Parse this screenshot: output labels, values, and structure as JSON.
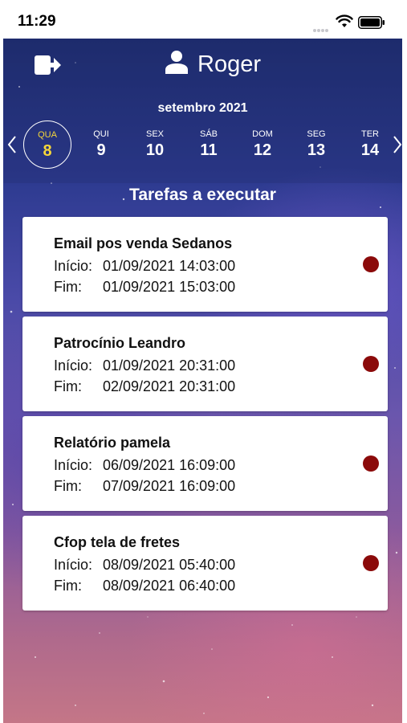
{
  "status_bar": {
    "time": "11:29"
  },
  "header": {
    "user_name": "Roger",
    "logout_icon": "logout-icon",
    "user_icon": "user-icon"
  },
  "calendar": {
    "month": "setembro 2021",
    "days": [
      {
        "dow": "QUA",
        "num": "8",
        "selected": true
      },
      {
        "dow": "QUI",
        "num": "9"
      },
      {
        "dow": "SEX",
        "num": "10"
      },
      {
        "dow": "SÁB",
        "num": "11"
      },
      {
        "dow": "DOM",
        "num": "12"
      },
      {
        "dow": "SEG",
        "num": "13"
      },
      {
        "dow": "TER",
        "num": "14"
      }
    ],
    "selected_color": "#f5d63a"
  },
  "section_title": "Tarefas a executar",
  "labels": {
    "start": "Início:",
    "end": "Fim:"
  },
  "tasks": [
    {
      "title": "Email pos venda Sedanos",
      "start": "01/09/2021 14:03:00",
      "end": "01/09/2021 15:03:00"
    },
    {
      "title": "Patrocínio Leandro",
      "start": "01/09/2021 20:31:00",
      "end": "02/09/2021 20:31:00"
    },
    {
      "title": "Relatório pamela",
      "start": "06/09/2021 16:09:00",
      "end": "07/09/2021 16:09:00"
    },
    {
      "title": "Cfop tela de fretes",
      "start": "08/09/2021 05:40:00",
      "end": "08/09/2021 06:40:00"
    }
  ],
  "colors": {
    "status_dot": "#8b0a0a",
    "accent": "#f5d63a"
  }
}
